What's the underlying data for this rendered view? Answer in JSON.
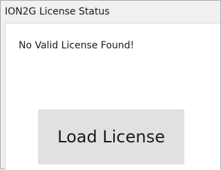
{
  "window": {
    "title": "ION2G License Status"
  },
  "main": {
    "status_text": "No Valid License Found!",
    "load_button_label": "Load License"
  }
}
